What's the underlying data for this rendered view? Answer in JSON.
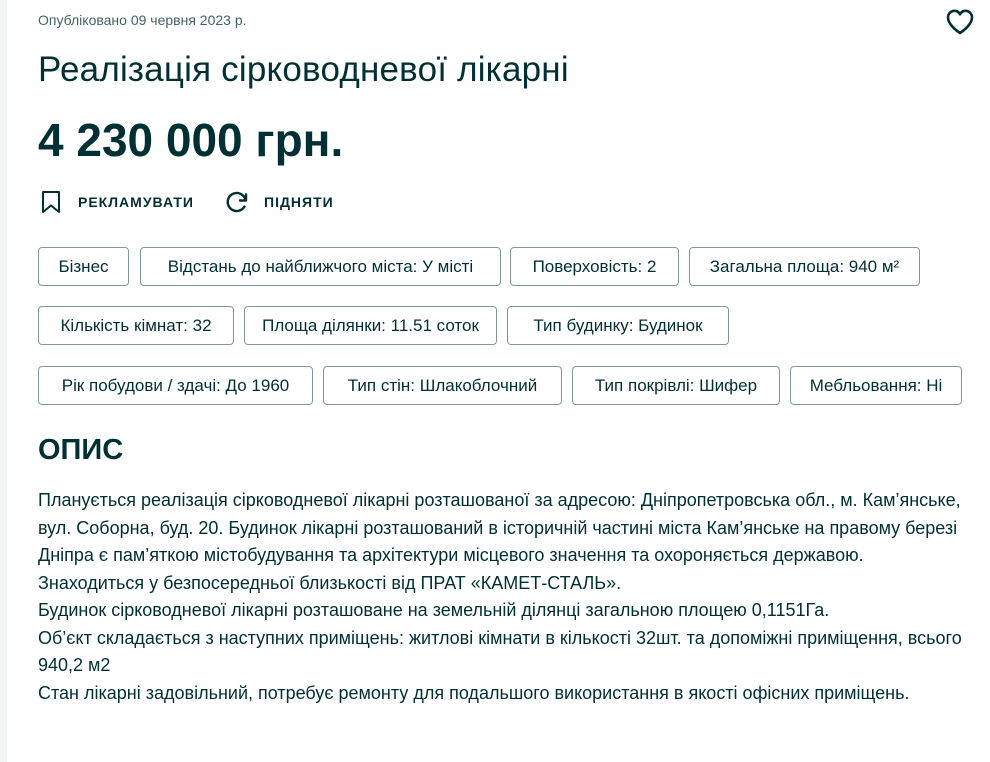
{
  "published": "Опубліковано 09 червня 2023 р.",
  "title": "Реалізація сірководневої лікарні",
  "price": "4 230 000 грн.",
  "actions": {
    "promote": "РЕКЛАМУВАТИ",
    "raise": "ПІДНЯТИ"
  },
  "tags": [
    "Бізнес",
    "Відстань до найближчого міста: У місті",
    "Поверховість: 2",
    "Загальна площа: 940 м²",
    "Кількість кімнат: 32",
    "Площа ділянки: 11.51 соток",
    "Тип будинку: Будинок",
    "Рік побудови / здачі: До 1960",
    "Тип стін: Шлакоблочний",
    "Тип покрівлі: Шифер",
    "Мебльовання: Ні"
  ],
  "description": {
    "heading": "ОПИС",
    "paragraphs": [
      "Планується реалізація сірководневої лікарні розташованої за адресою: Дніпропетровська обл., м. Кам’янське, вул. Соборна, буд. 20. Будинок лікарні розташований в історичній частині міста Кам’янське на правому березі Дніпра є пам’яткою містобудування та архітектури місцевого значення та охороняється державою. Знаходиться у безпосередньої близькості від ПРАТ «КАМЕТ-СТАЛЬ».",
      "Будинок сірководневої лікарні розташоване на земельній ділянці загальною площею 0,1151Га.",
      "Об’єкт складається з наступних приміщень: житлові кімнати в кількості 32шт. та допоміжні приміщення, всього 940,2 м2",
      "Стан лікарні задовільний, потребує ремонту для подальшого використання в якості офісних приміщень."
    ]
  },
  "icons": {
    "favorite": "heart-outline-icon",
    "promote": "bookmark-icon",
    "raise": "refresh-icon"
  },
  "colors": {
    "text": "#002f34",
    "muted": "#406367",
    "border": "#7f9799"
  }
}
